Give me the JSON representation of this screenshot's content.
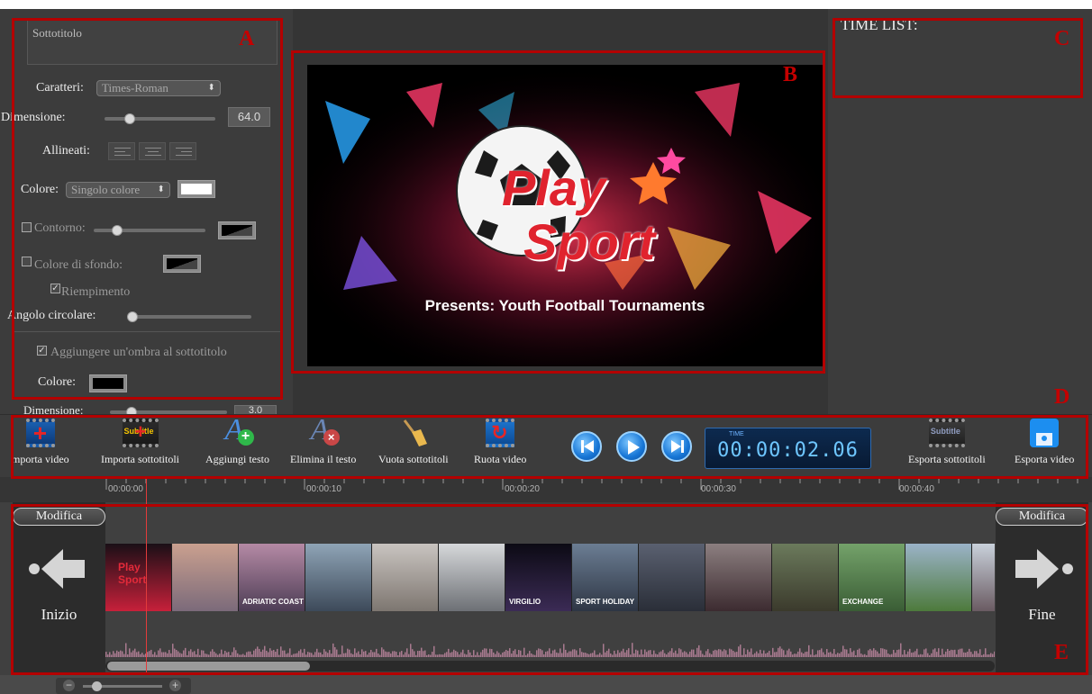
{
  "subtitle_panel": {
    "subtitle_placeholder": "Sottotitolo",
    "font_label": "Caratteri:",
    "font_value": "Times-Roman",
    "size_label": "Dimensione:",
    "size_value": "64.0",
    "size_slider_fraction": 0.2,
    "align_label": "Allineati:",
    "color_label": "Colore:",
    "color_mode_value": "Singolo colore",
    "text_color": "#ffffff",
    "outline_label": "Contorno:",
    "outline_checked": false,
    "bg_color_label": "Colore di sfondo:",
    "bg_color_checked": false,
    "fill_label": "Riempimento",
    "fill_checked": true,
    "corner_label": "Angolo circolare:",
    "shadow_label": "Aggiungere un'ombra al sottotitolo",
    "shadow_checked": true,
    "shadow_color_label": "Colore:",
    "shadow_color": "#000000",
    "shadow_size_label": "Dimensione:",
    "shadow_size_value": "3.0"
  },
  "preview": {
    "logo_line1": "Play",
    "logo_line2": "Sport",
    "caption": "Presents:  Youth Football Tournaments"
  },
  "time_list": {
    "title": "TIME LIST:"
  },
  "toolbar": {
    "import_video": "mporta video",
    "import_subtitles": "Importa sottotitoli",
    "add_text": "Aggiungi testo",
    "delete_text": "Elimina il testo",
    "clear_subtitles": "Vuota sottotitoli",
    "rotate_video": "Ruota video",
    "export_subtitles": "Esporta sottotitoli",
    "export_video": "Esporta video",
    "timecode_label": "TIME",
    "timecode": "00:00:02.06"
  },
  "ruler": {
    "ticks": [
      "00:00:00",
      "00:00:10",
      "00:00:20",
      "00:00:30",
      "00:00:40"
    ]
  },
  "timeline": {
    "edit_left": "Modifica",
    "edit_right": "Modifica",
    "start_label": "Inizio",
    "end_label": "Fine",
    "thumbnail_texts": [
      "Play Sport",
      "ADRIATIC COAST",
      "VIRGILIO",
      "SPORT HOLIDAY",
      "EXCHANGE"
    ]
  },
  "regions": {
    "a": "A",
    "b": "B",
    "c": "C",
    "d": "D",
    "e": "E"
  },
  "colors": {
    "annotation_red": "#b40000",
    "accent_blue": "#1776d6",
    "playhead": "#e23b3b"
  }
}
